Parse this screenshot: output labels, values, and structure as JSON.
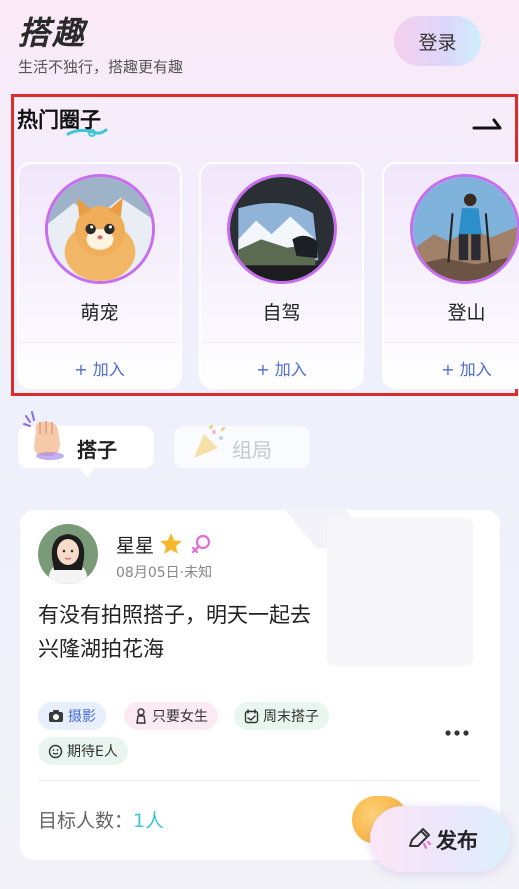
{
  "header": {
    "app_title": "搭趣",
    "subtitle": "生活不独行，搭趣更有趣",
    "login_label": "登录"
  },
  "hot_circles": {
    "title": "热门圈子",
    "items": [
      {
        "name": "萌宠",
        "join_label": "+ 加入",
        "icon": "cat-photo"
      },
      {
        "name": "自驾",
        "join_label": "+ 加入",
        "icon": "car-window-photo"
      },
      {
        "name": "登山",
        "join_label": "+ 加入",
        "icon": "hiker-photo"
      }
    ]
  },
  "tabs": [
    {
      "label": "搭子",
      "active": true,
      "icon": "hand-icon"
    },
    {
      "label": "组局",
      "active": false,
      "icon": "party-icon"
    }
  ],
  "post": {
    "user_name": "星星",
    "meta": "08月05日·未知",
    "text": "有没有拍照搭子，明天一起去兴隆湖拍花海",
    "tags": [
      "摄影",
      "只要女生",
      "周末搭子",
      "期待E人"
    ],
    "target_label": "目标人数：",
    "target_value": "1人"
  },
  "publish_label": "发布",
  "colors": {
    "accent_blue": "#4a6cd4",
    "ring_purple": "#c86cf0",
    "highlight_box": "#e02b2b",
    "target_teal": "#3cc7d6"
  }
}
